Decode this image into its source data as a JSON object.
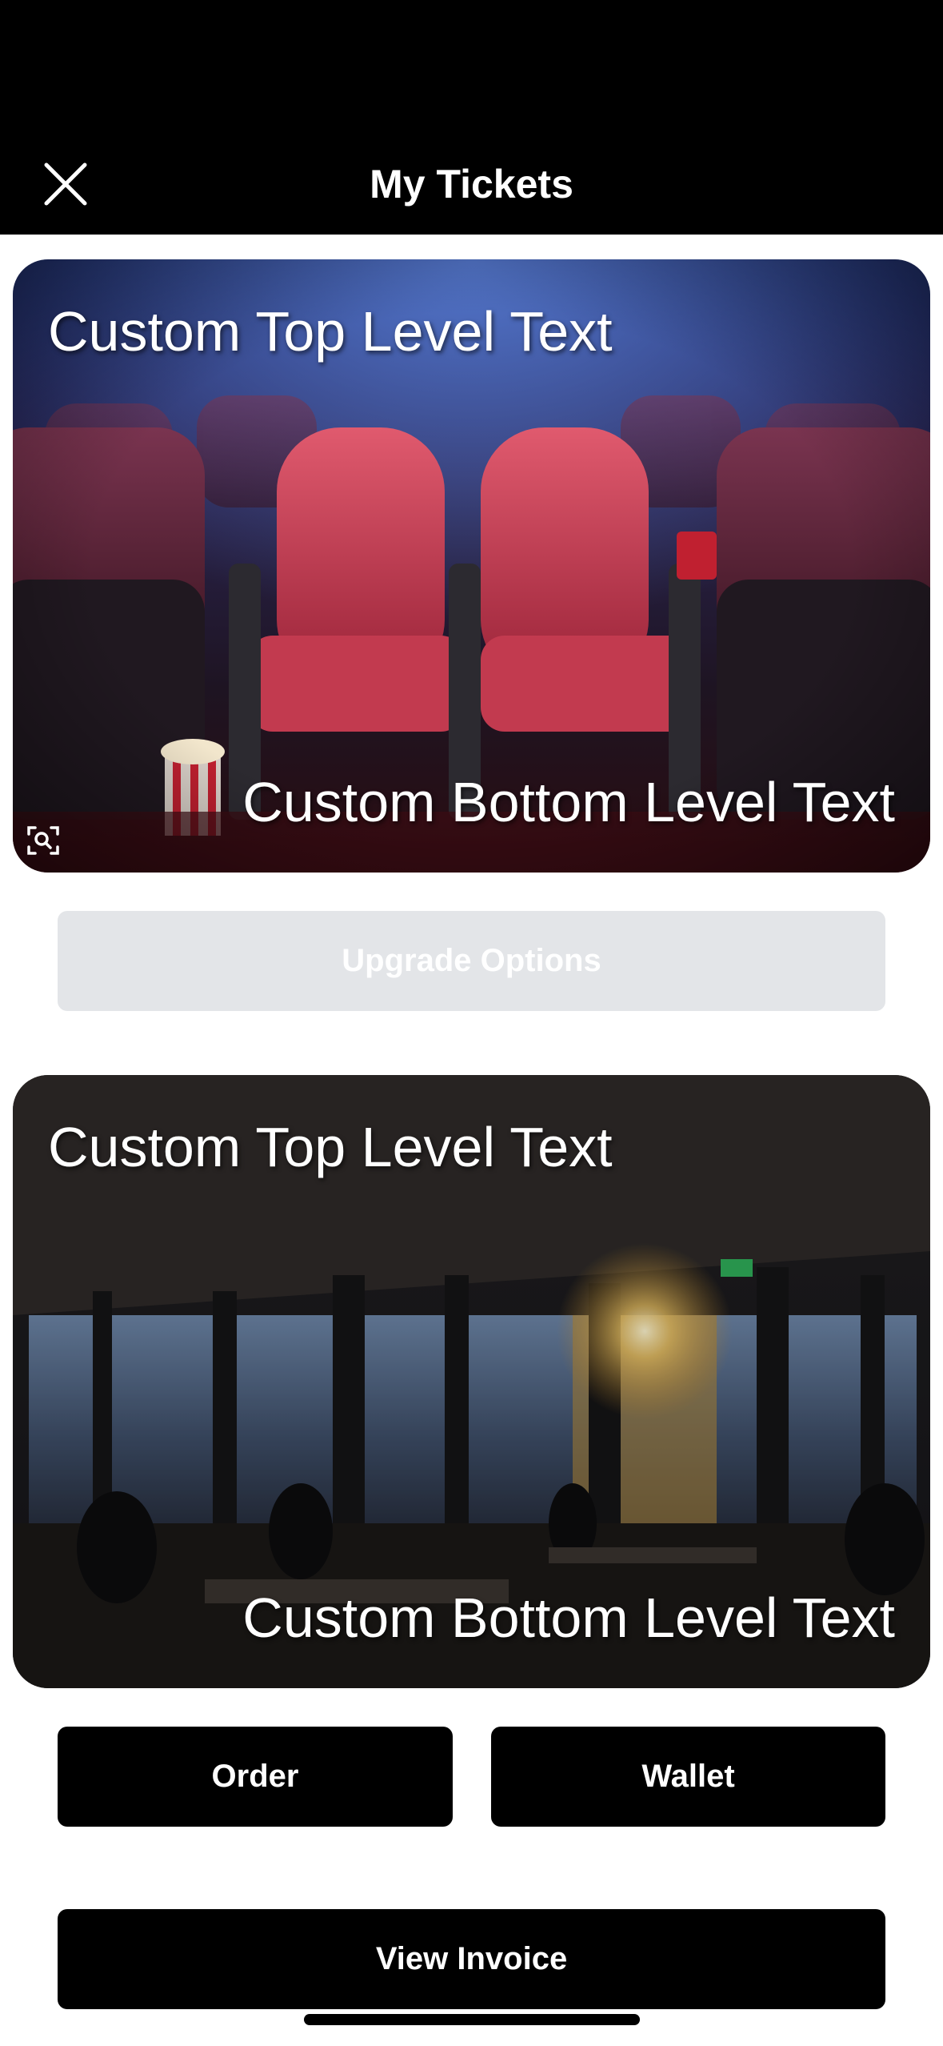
{
  "header": {
    "title": "My Tickets",
    "close_icon": "close-icon"
  },
  "tickets": [
    {
      "top_text": "Custom Top Level Text",
      "bottom_text": "Custom Bottom Level Text",
      "image": "cinema-seats-image"
    },
    {
      "top_text": "Custom Top Level Text",
      "bottom_text": "Custom Bottom Level Text",
      "image": "rooftop-restaurant-image"
    }
  ],
  "actions": {
    "upgrade_label": "Upgrade Options",
    "order_label": "Order",
    "wallet_label": "Wallet",
    "invoice_label": "View Invoice"
  },
  "colors": {
    "header_bg": "#000000",
    "disabled_button": "#e3e5e8",
    "primary_button": "#000000"
  }
}
